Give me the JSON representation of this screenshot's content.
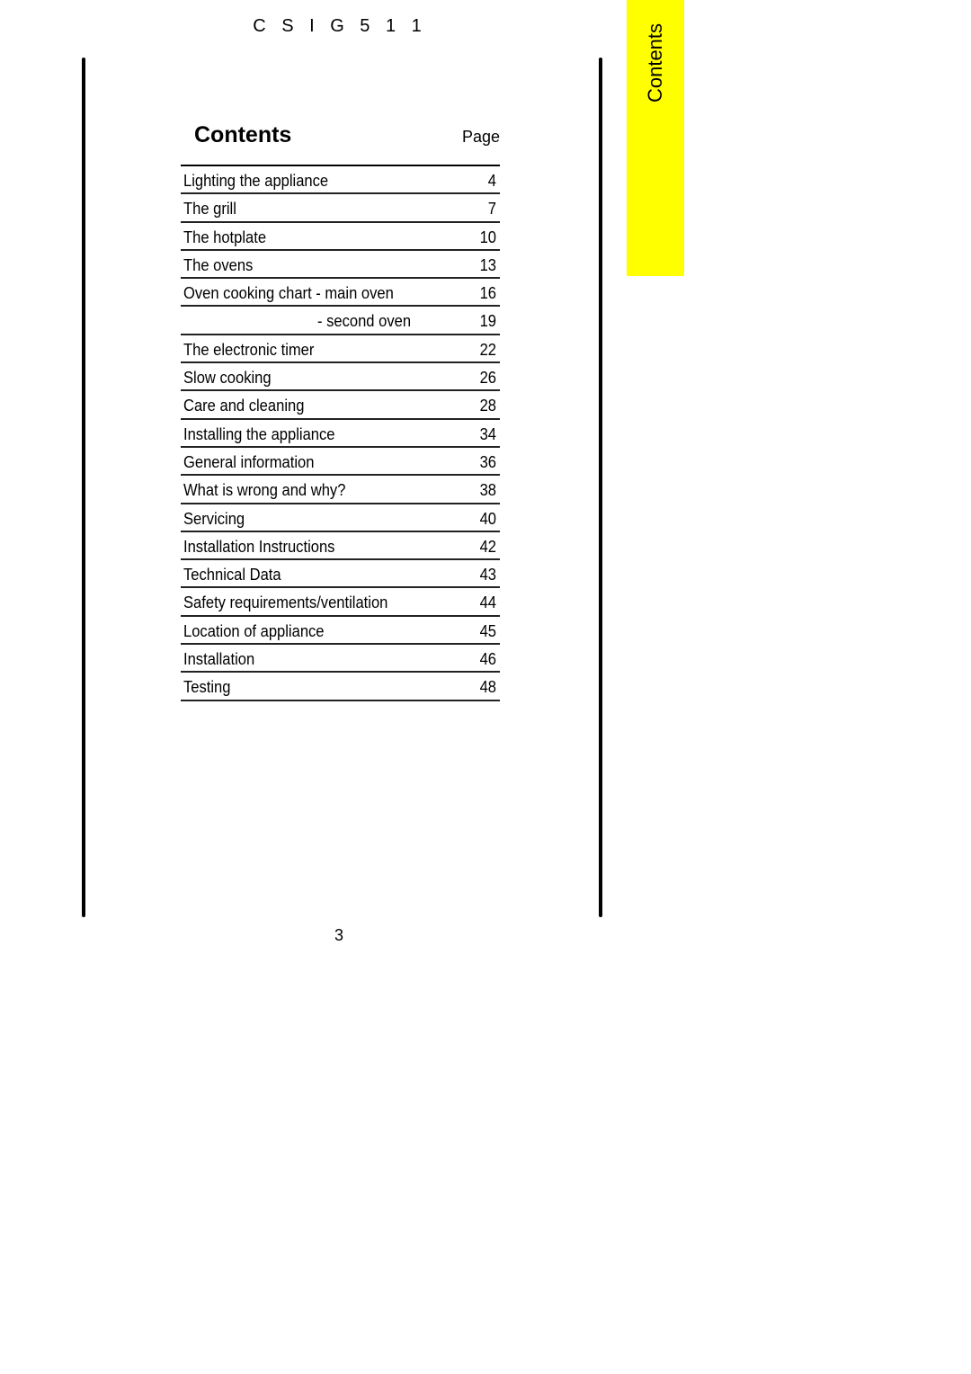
{
  "header": {
    "model": "C S I G  5 1 1"
  },
  "side_tab": {
    "label": "Contents",
    "color": "#ffff00"
  },
  "toc": {
    "title": "Contents",
    "page_column_label": "Page",
    "entries": [
      {
        "label": "Lighting the appliance",
        "page": "4"
      },
      {
        "label": "The grill",
        "page": "7"
      },
      {
        "label": "The hotplate",
        "page": "10"
      },
      {
        "label": "The ovens",
        "page": "13"
      },
      {
        "label": "Oven cooking chart - main oven",
        "page": "16"
      },
      {
        "label": "- second oven",
        "page": "19"
      },
      {
        "label": "The electronic timer",
        "page": "22"
      },
      {
        "label": "Slow cooking",
        "page": "26"
      },
      {
        "label": "Care and cleaning",
        "page": "28"
      },
      {
        "label": "Installing the appliance",
        "page": "34"
      },
      {
        "label": "General information",
        "page": "36"
      },
      {
        "label": "What is wrong and why?",
        "page": "38"
      },
      {
        "label": "Servicing",
        "page": "40"
      },
      {
        "label": "Installation Instructions",
        "page": "42"
      },
      {
        "label": "Technical Data",
        "page": "43"
      },
      {
        "label": "Safety requirements/ventilation",
        "page": "44"
      },
      {
        "label": "Location of appliance",
        "page": "45"
      },
      {
        "label": "Installation",
        "page": "46"
      },
      {
        "label": "Testing",
        "page": "48"
      }
    ]
  },
  "footer": {
    "page_number": "3"
  }
}
